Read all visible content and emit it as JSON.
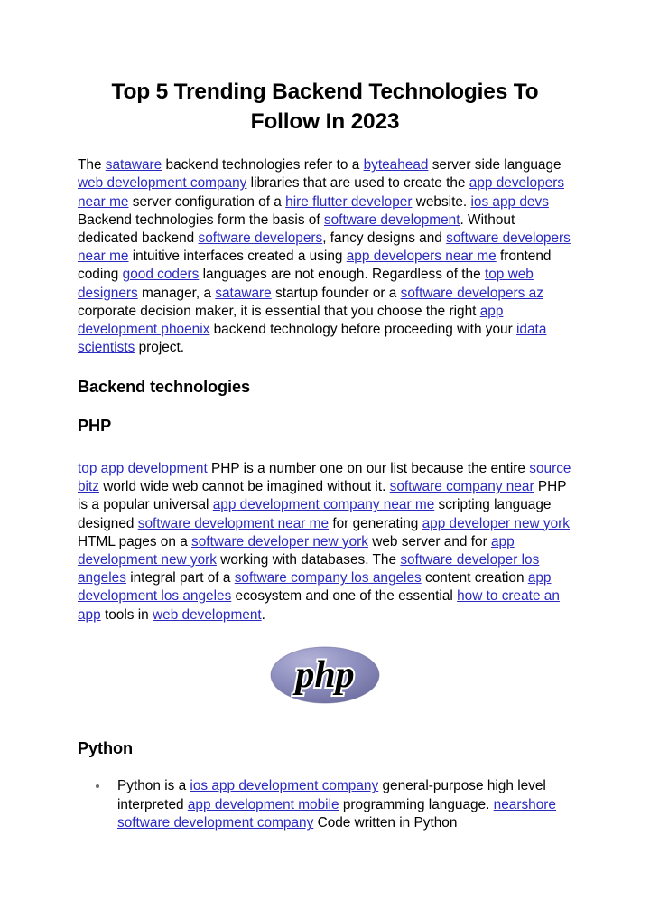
{
  "document": {
    "title": "Top 5 Trending Backend Technologies To Follow In 2023",
    "background_color": "#ffffff",
    "text_color": "#000000",
    "link_color": "#2a2ac0",
    "bullet_color": "#6b6b6b"
  },
  "intro_paragraph": {
    "segments": [
      {
        "type": "text",
        "value": "The "
      },
      {
        "type": "link",
        "value": "sataware"
      },
      {
        "type": "text",
        "value": " backend technologies refer to a "
      },
      {
        "type": "link",
        "value": "byteahead"
      },
      {
        "type": "text",
        "value": " server side language "
      },
      {
        "type": "link",
        "value": "web development company"
      },
      {
        "type": "text",
        "value": " libraries that are used to create the "
      },
      {
        "type": "link",
        "value": "app developers near me"
      },
      {
        "type": "text",
        "value": " server configuration of a "
      },
      {
        "type": "link",
        "value": "hire flutter developer"
      },
      {
        "type": "text",
        "value": " website. "
      },
      {
        "type": "link",
        "value": "ios app devs"
      },
      {
        "type": "text",
        "value": " Backend technologies form the basis of "
      },
      {
        "type": "link",
        "value": "software development"
      },
      {
        "type": "text",
        "value": ". Without dedicated backend "
      },
      {
        "type": "link",
        "value": "software developers"
      },
      {
        "type": "text",
        "value": ", fancy designs and "
      },
      {
        "type": "link",
        "value": "software developers near me"
      },
      {
        "type": "text",
        "value": " intuitive interfaces created a using "
      },
      {
        "type": "link",
        "value": "app developers near me"
      },
      {
        "type": "text",
        "value": " frontend coding "
      },
      {
        "type": "link",
        "value": "good coders"
      },
      {
        "type": "text",
        "value": " languages are not enough. Regardless of the "
      },
      {
        "type": "link",
        "value": "top web designers"
      },
      {
        "type": "text",
        "value": " manager, a "
      },
      {
        "type": "link",
        "value": "sataware"
      },
      {
        "type": "text",
        "value": " startup founder or a "
      },
      {
        "type": "link",
        "value": "software developers az"
      },
      {
        "type": "text",
        "value": " corporate decision maker, it is essential that you choose the right "
      },
      {
        "type": "link",
        "value": "app development phoenix"
      },
      {
        "type": "text",
        "value": " backend technology before proceeding with your "
      },
      {
        "type": "link",
        "value": "idata scientists"
      },
      {
        "type": "text",
        "value": " project."
      }
    ]
  },
  "headings": {
    "backend_technologies": "Backend technologies",
    "php": "PHP",
    "python": "Python"
  },
  "php_paragraph": {
    "segments": [
      {
        "type": "link",
        "value": "top app development"
      },
      {
        "type": "text",
        "value": " PHP is a number one on our list because the entire "
      },
      {
        "type": "link",
        "value": "source bitz"
      },
      {
        "type": "text",
        "value": " world wide web cannot be imagined without it. "
      },
      {
        "type": "link",
        "value": "software company near"
      },
      {
        "type": "text",
        "value": " PHP is a popular universal "
      },
      {
        "type": "link",
        "value": "app development company near me"
      },
      {
        "type": "text",
        "value": " scripting language designed "
      },
      {
        "type": "link",
        "value": "software development near me"
      },
      {
        "type": "text",
        "value": " for generating "
      },
      {
        "type": "link",
        "value": "app developer new york"
      },
      {
        "type": "text",
        "value": " HTML pages on a "
      },
      {
        "type": "link",
        "value": "software developer new york"
      },
      {
        "type": "text",
        "value": " web server and for "
      },
      {
        "type": "link",
        "value": "app development new york"
      },
      {
        "type": "text",
        "value": " working with databases. The "
      },
      {
        "type": "link",
        "value": "software developer los angeles"
      },
      {
        "type": "text",
        "value": " integral part of a "
      },
      {
        "type": "link",
        "value": "software company los angeles"
      },
      {
        "type": "text",
        "value": " content creation "
      },
      {
        "type": "link",
        "value": "app development los angeles"
      },
      {
        "type": "text",
        "value": " ecosystem and one of the essential "
      },
      {
        "type": "link",
        "value": "how to create an app"
      },
      {
        "type": "text",
        "value": " tools in "
      },
      {
        "type": "link",
        "value": "web development"
      },
      {
        "type": "text",
        "value": "."
      }
    ]
  },
  "php_logo": {
    "alt_text": "php",
    "wordmark": "php",
    "ellipse_color_light": "#a3a3cc",
    "ellipse_color_mid": "#8b8bbd",
    "ellipse_color_dark": "#6c6c9e",
    "text_color": "#000000",
    "outline_color": "#ffffff"
  },
  "python_list": {
    "items": [
      {
        "segments": [
          {
            "type": "text",
            "value": "Python is a "
          },
          {
            "type": "link",
            "value": "ios app development company"
          },
          {
            "type": "text",
            "value": " general-purpose high level interpreted "
          },
          {
            "type": "link",
            "value": "app development mobile"
          },
          {
            "type": "text",
            "value": " programming language. "
          },
          {
            "type": "link",
            "value": "nearshore software development company"
          },
          {
            "type": "text",
            "value": " Code written in Python"
          }
        ]
      }
    ]
  }
}
